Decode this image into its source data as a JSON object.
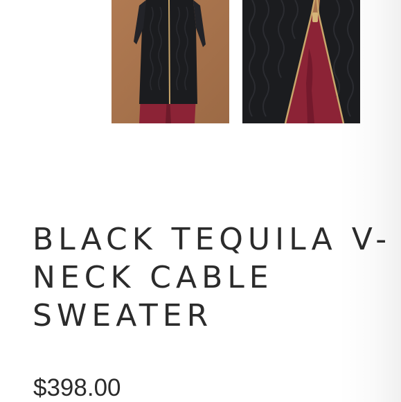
{
  "product": {
    "title_lines": [
      "BLACK TEQUILA V-",
      "NECK CABLE",
      "SWEATER"
    ],
    "price": "$398.00"
  },
  "gallery": {
    "thumbnails": [
      {
        "name": "back-view-thumbnail",
        "icon": "product-photo"
      },
      {
        "name": "zipper-detail-thumbnail",
        "icon": "product-photo"
      }
    ]
  },
  "colors": {
    "backdrop": "#a8744f",
    "sweater": "#1b1c1f",
    "pants": "#8c2336",
    "zipper": "#c9a66b",
    "text": "#2b2b2b"
  }
}
